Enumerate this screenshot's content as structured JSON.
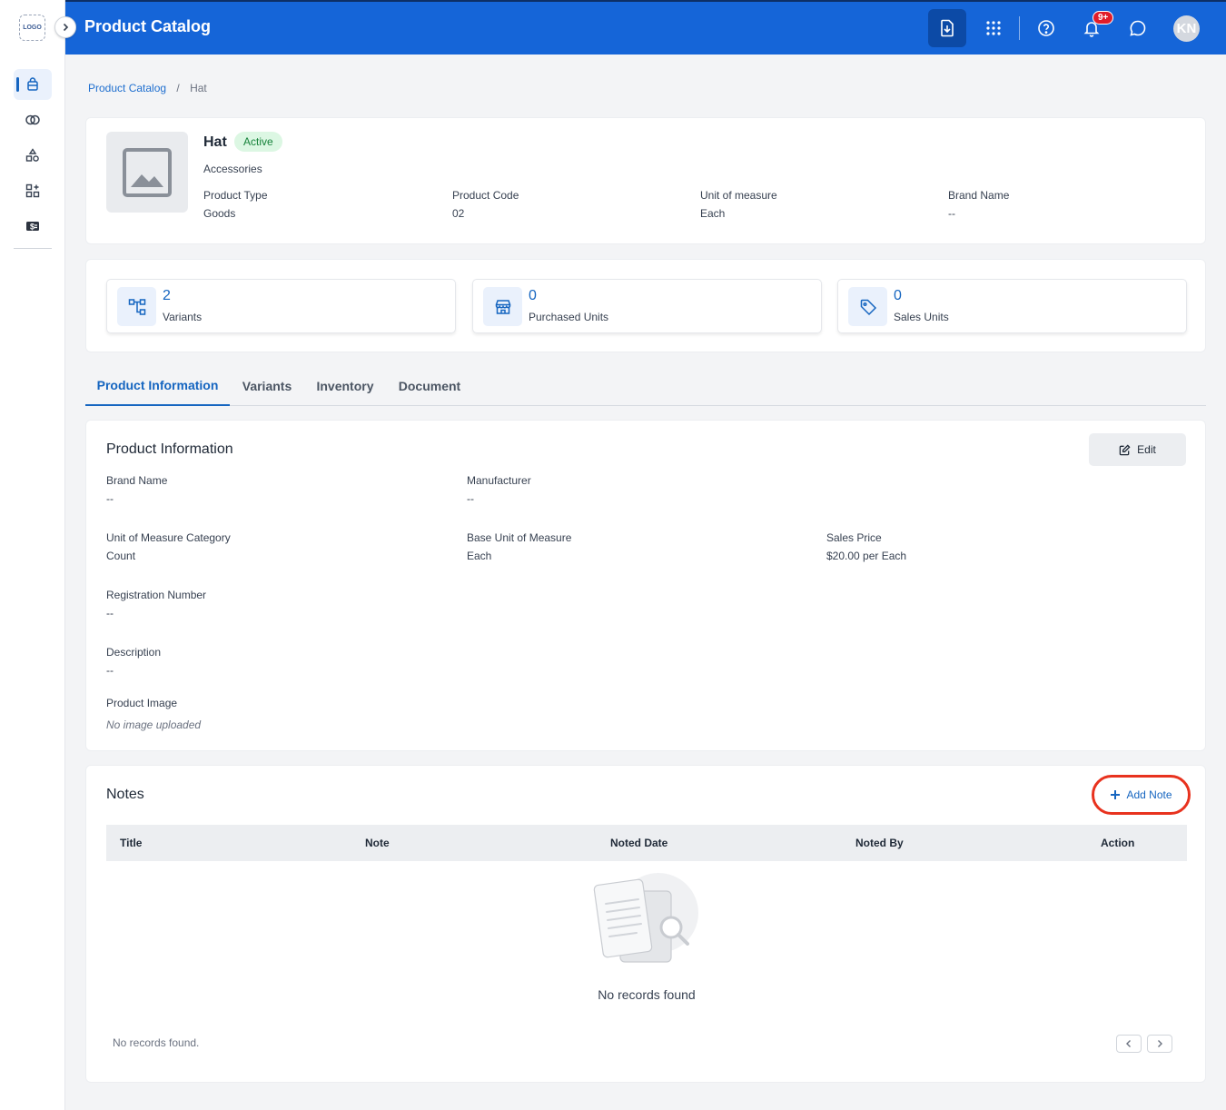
{
  "app": {
    "logo_text": "LOGO",
    "title": "Product Catalog",
    "notification_count": "9+",
    "user_initials": "KN"
  },
  "sidebar": {
    "items": [
      {
        "icon": "catalog-icon",
        "active": true
      },
      {
        "icon": "circles-icon",
        "active": false
      },
      {
        "icon": "shapes-icon",
        "active": false
      },
      {
        "icon": "apps-icon",
        "active": false
      },
      {
        "icon": "money-icon",
        "active": false
      }
    ]
  },
  "breadcrumb": {
    "parent": "Product Catalog",
    "separator": "/",
    "current": "Hat"
  },
  "product": {
    "name": "Hat",
    "status": "Active",
    "category": "Accessories",
    "meta": [
      {
        "label": "Product Type",
        "value": "Goods"
      },
      {
        "label": "Product Code",
        "value": "02"
      },
      {
        "label": "Unit of measure",
        "value": "Each"
      },
      {
        "label": "Brand Name",
        "value": "--"
      }
    ]
  },
  "stats": [
    {
      "value": "2",
      "label": "Variants",
      "icon": "hierarchy-icon"
    },
    {
      "value": "0",
      "label": "Purchased Units",
      "icon": "store-icon"
    },
    {
      "value": "0",
      "label": "Sales Units",
      "icon": "tag-icon"
    }
  ],
  "tabs": [
    "Product Information",
    "Variants",
    "Inventory",
    "Document"
  ],
  "info": {
    "title": "Product Information",
    "edit_label": "Edit",
    "fields": {
      "brand_name": {
        "label": "Brand Name",
        "value": "--"
      },
      "manufacturer": {
        "label": "Manufacturer",
        "value": "--"
      },
      "uom_category": {
        "label": "Unit of Measure Category",
        "value": "Count"
      },
      "base_uom": {
        "label": "Base Unit of Measure",
        "value": "Each"
      },
      "sales_price": {
        "label": "Sales Price",
        "value": "$20.00 per Each"
      },
      "registration": {
        "label": "Registration Number",
        "value": "--"
      },
      "description": {
        "label": "Description",
        "value": "--"
      },
      "image": {
        "label": "Product Image",
        "value": "No image uploaded"
      }
    }
  },
  "notes": {
    "title": "Notes",
    "add_label": "Add Note",
    "columns": [
      "Title",
      "Note",
      "Noted Date",
      "Noted By",
      "Action"
    ],
    "empty_message": "No records found",
    "footer": "No records found.",
    "accent": "#e8321e"
  }
}
